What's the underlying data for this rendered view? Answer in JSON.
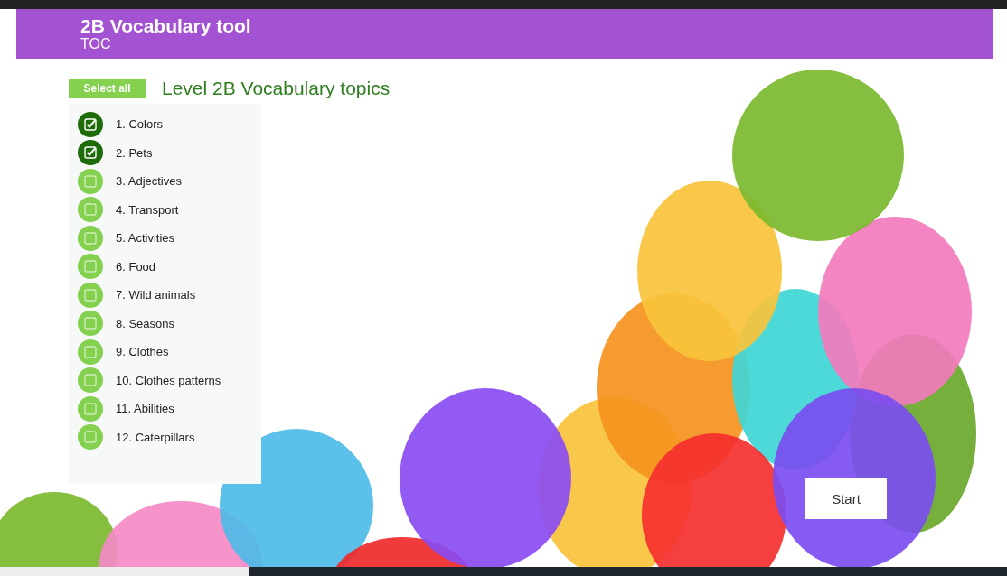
{
  "header": {
    "title": "2B Vocabulary tool",
    "subtitle": "TOC"
  },
  "select_all": {
    "label": "Select all"
  },
  "heading": "Level 2B Vocabulary topics",
  "topics": [
    {
      "label": "1. Colors",
      "checked": true
    },
    {
      "label": "2. Pets",
      "checked": true
    },
    {
      "label": "3. Adjectives",
      "checked": false
    },
    {
      "label": "4. Transport",
      "checked": false
    },
    {
      "label": "5. Activities",
      "checked": false
    },
    {
      "label": "6. Food",
      "checked": false
    },
    {
      "label": "7. Wild animals",
      "checked": false
    },
    {
      "label": "8. Seasons",
      "checked": false
    },
    {
      "label": "9. Clothes",
      "checked": false
    },
    {
      "label": "10. Clothes patterns",
      "checked": false
    },
    {
      "label": "11. Abilities",
      "checked": false
    },
    {
      "label": "12. Caterpillars",
      "checked": false
    }
  ],
  "start_button": {
    "label": "Start"
  }
}
